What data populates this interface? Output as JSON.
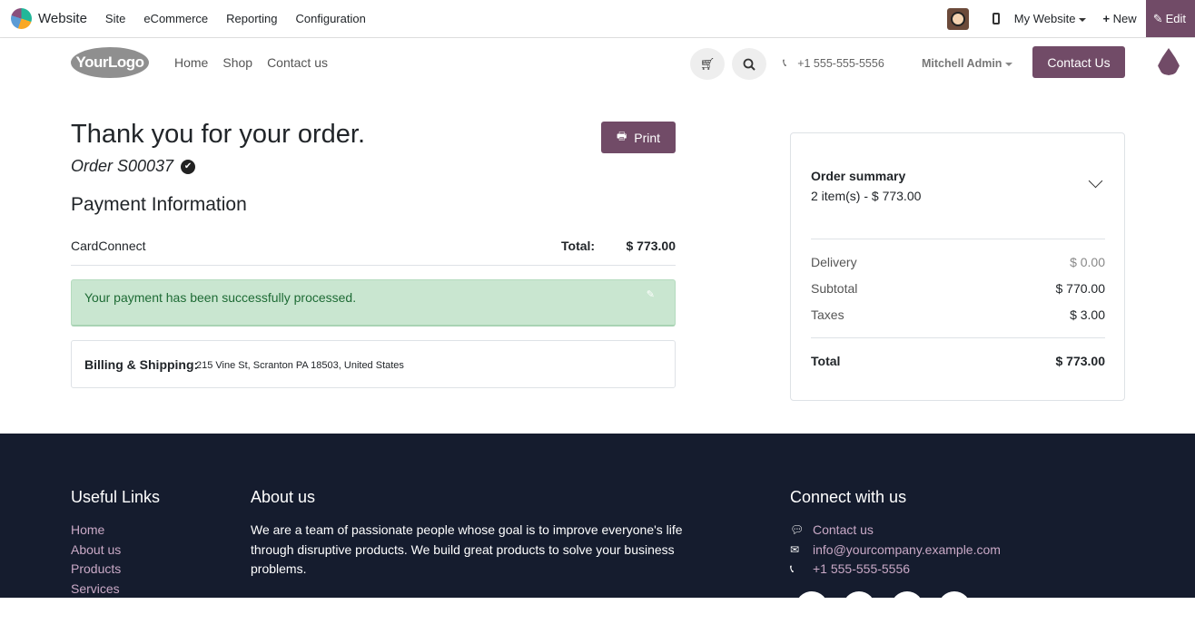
{
  "topbar": {
    "app_name": "Website",
    "menu": [
      "Site",
      "eCommerce",
      "Reporting",
      "Configuration"
    ],
    "my_website": "My Website",
    "new_label": "New",
    "edit_label": "Edit"
  },
  "header": {
    "logo_text": "YourLogo",
    "nav": [
      "Home",
      "Shop",
      "Contact us"
    ],
    "phone": "+1 555-555-5556",
    "user": "Mitchell Admin",
    "contact_button": "Contact Us"
  },
  "confirmation": {
    "heading": "Thank you for your order.",
    "order_ref": "Order S00037",
    "print_label": "Print",
    "payment_heading": "Payment Information",
    "provider": "CardConnect",
    "total_label": "Total:",
    "total_value": "$ 773.00",
    "success_message": "Your payment has been successfully processed.",
    "billing_label": "Billing & Shipping:",
    "billing_address": "215 Vine St, Scranton PA 18503, United States"
  },
  "summary": {
    "title": "Order summary",
    "items_text": "2 item(s) -  $ 773.00",
    "rows": [
      {
        "label": "Delivery",
        "value": "$ 0.00"
      },
      {
        "label": "Subtotal",
        "value": "$ 770.00"
      },
      {
        "label": "Taxes",
        "value": "$ 3.00"
      }
    ],
    "total_label": "Total",
    "total_value": "$ 773.00"
  },
  "footer": {
    "useful_links_heading": "Useful Links",
    "useful_links": [
      "Home",
      "About us",
      "Products",
      "Services"
    ],
    "about_heading": "About us",
    "about_text": "We are a team of passionate people whose goal is to improve everyone's life through disruptive products. We build great products to solve your business problems.",
    "connect_heading": "Connect with us",
    "connect": [
      "Contact us",
      "info@yourcompany.example.com",
      "+1 555-555-5556"
    ]
  },
  "colors": {
    "brand": "#714b67",
    "footer_bg": "#151c2e",
    "success_bg": "#c9e6d0",
    "success_text": "#1e6b35"
  }
}
